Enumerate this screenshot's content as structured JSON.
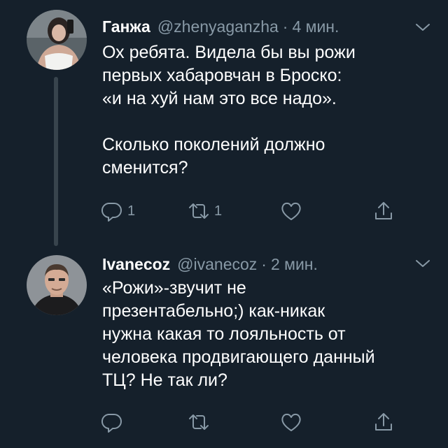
{
  "tweets": [
    {
      "name": "Ганжа",
      "handle": "@zhenyaganzha",
      "separator": "·",
      "time": "4 мин.",
      "text": "Ох ребята. Видела бы вы рожи\nпервых хабаровчан в Броско:\n«и на хуй нам это все надо».\n\nСколько поколений должно\nсменится?",
      "reply_count": "1",
      "retweet_count": "1",
      "like_count": "",
      "avatar_icon": "avatar-photo-woman"
    },
    {
      "name": "Ivanecoz",
      "handle": "@ivanecoz",
      "separator": "·",
      "time": "2 мин.",
      "text": "«Рожи»-звучит не\nпрезентабельно;) как-никак\nнужна какая то лояльность от\nчеловека продвигающего данный\nТЦ? Не так ли?",
      "reply_count": "",
      "retweet_count": "",
      "like_count": "",
      "avatar_icon": "avatar-photo-man"
    }
  ],
  "icons": {
    "reply": "reply-icon",
    "retweet": "retweet-icon",
    "like": "heart-icon",
    "share": "share-icon",
    "menu": "chevron-down-icon"
  },
  "colors": {
    "background": "#15202b",
    "text": "#ffffff",
    "secondary": "#8899a6",
    "thread_line": "#38444d"
  }
}
